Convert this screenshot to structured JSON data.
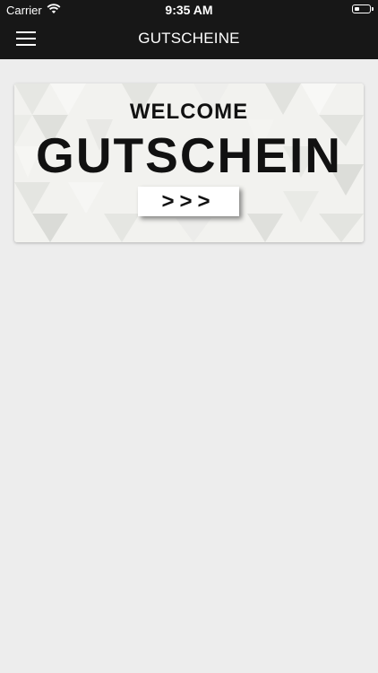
{
  "status_bar": {
    "carrier": "Carrier",
    "time": "9:35 AM"
  },
  "nav": {
    "title": "GUTSCHEINE"
  },
  "banner": {
    "line1": "WELCOME",
    "line2": "GUTSCHEIN",
    "button_label": ">>>"
  }
}
